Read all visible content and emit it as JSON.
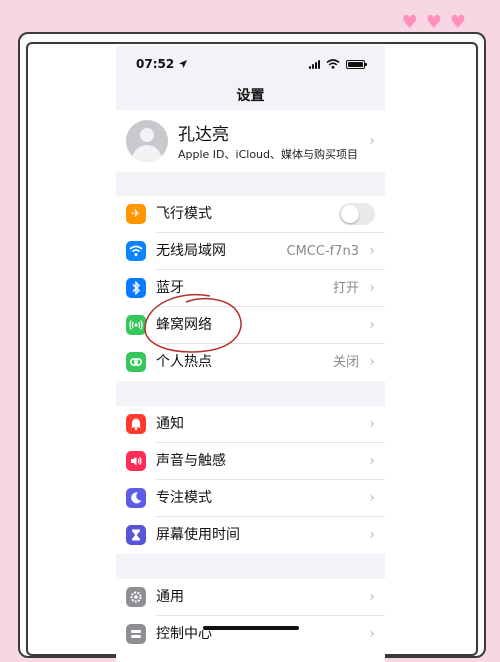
{
  "status": {
    "time": "07:52"
  },
  "nav": {
    "title": "设置"
  },
  "profile": {
    "name": "孔达亮",
    "subtitle": "Apple ID、iCloud、媒体与购买项目"
  },
  "network": [
    {
      "label": "飞行模式",
      "icon": "airplane-icon",
      "color": "#ff9500"
    },
    {
      "label": "无线局域网",
      "value": "CMCC-f7n3",
      "icon": "wifi-icon",
      "color": "#0a84ff"
    },
    {
      "label": "蓝牙",
      "value": "打开",
      "icon": "bluetooth-icon",
      "color": "#0a7aff"
    },
    {
      "label": "蜂窝网络",
      "icon": "cellular-icon",
      "color": "#34c759"
    },
    {
      "label": "个人热点",
      "value": "关闭",
      "icon": "hotspot-icon",
      "color": "#34c759"
    }
  ],
  "notify": [
    {
      "label": "通知",
      "icon": "notification-icon",
      "color": "#ff3b30"
    },
    {
      "label": "声音与触感",
      "icon": "sound-icon",
      "color": "#ff2d55"
    },
    {
      "label": "专注模式",
      "icon": "moon-icon",
      "color": "#5e5ce6"
    },
    {
      "label": "屏幕使用时间",
      "icon": "hourglass-icon",
      "color": "#5856d6"
    }
  ],
  "general": [
    {
      "label": "通用",
      "icon": "gear-icon",
      "color": "#8e8e93"
    },
    {
      "label": "控制中心",
      "icon": "control-center-icon",
      "color": "#8e8e93"
    }
  ]
}
